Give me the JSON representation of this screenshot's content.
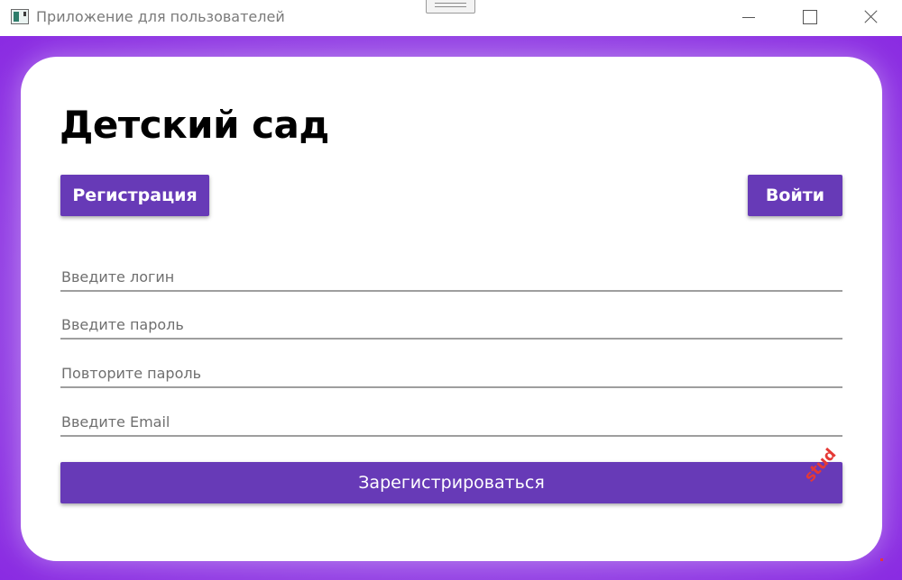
{
  "window": {
    "title": "Приложение для пользователей"
  },
  "page": {
    "title": "Детский сад"
  },
  "tabs": {
    "register_label": "Регистрация",
    "login_label": "Войти"
  },
  "form": {
    "login_placeholder": "Введите логин",
    "password_placeholder": "Введите пароль",
    "password_repeat_placeholder": "Повторите пароль",
    "email_placeholder": "Введите Email",
    "submit_label": "Зарегистрироваться"
  },
  "watermark": {
    "text": "stud"
  },
  "colors": {
    "accent": "#673ab7",
    "background": "#8a2be2"
  }
}
